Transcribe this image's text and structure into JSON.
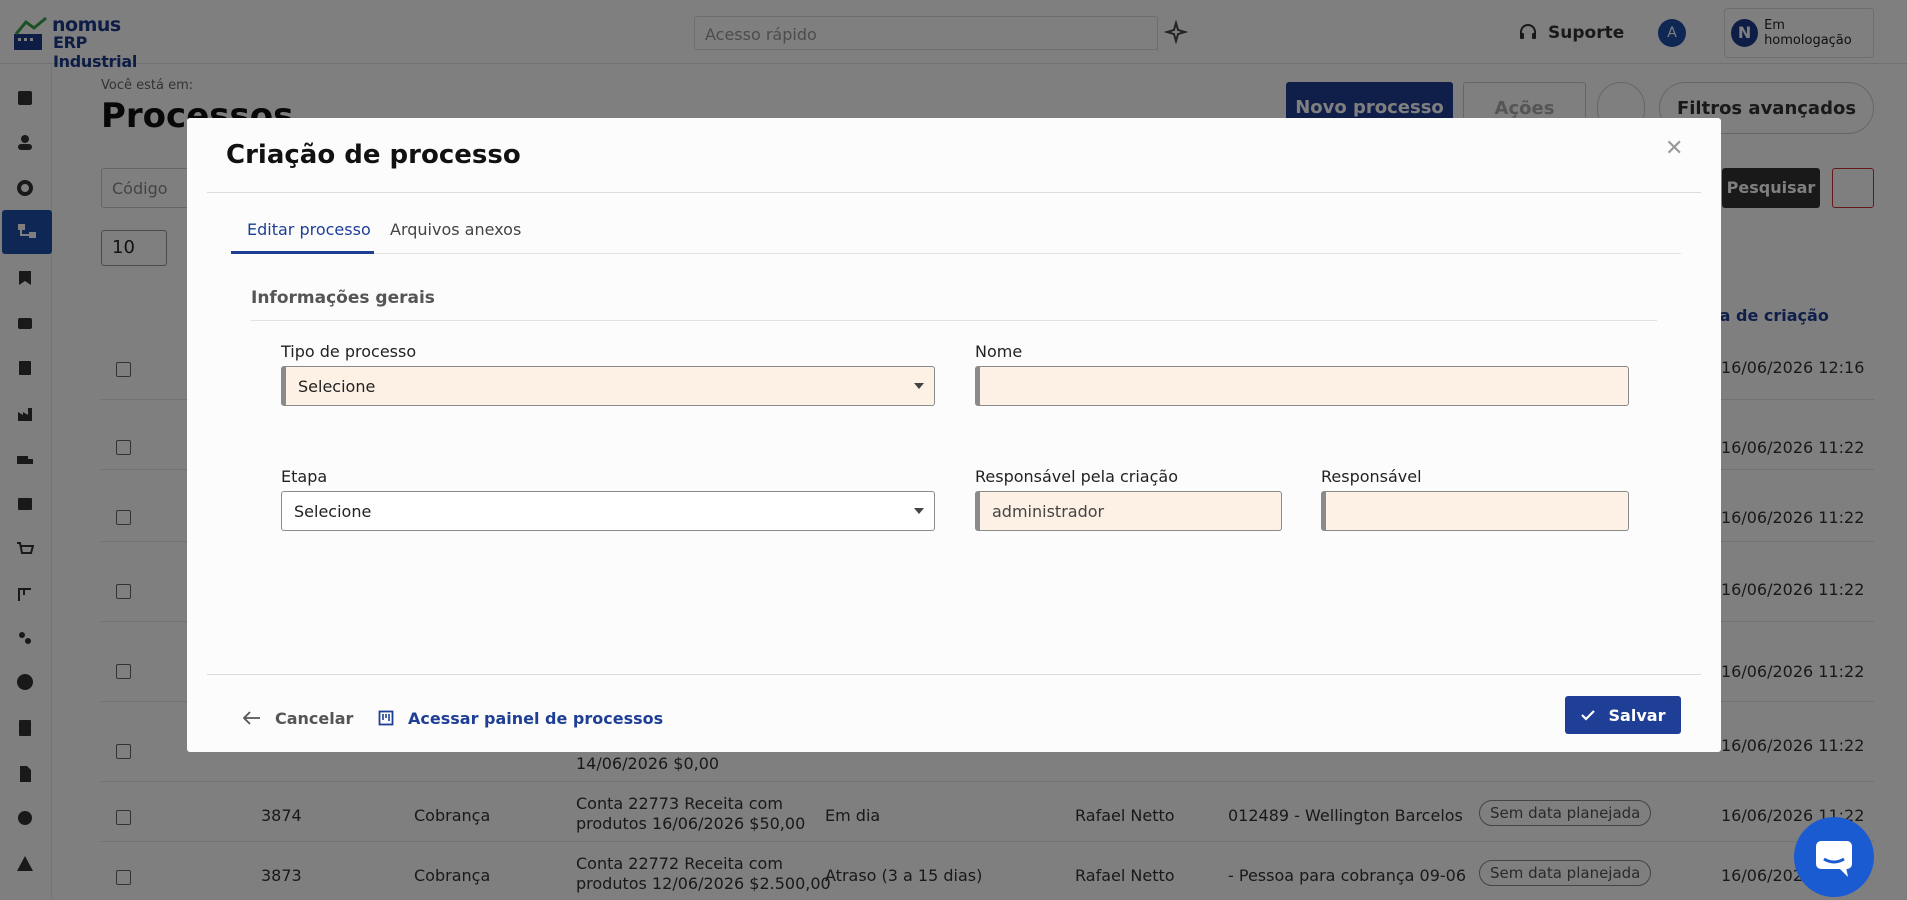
{
  "app": {
    "logo_line1": "nomus",
    "logo_line2": "ERP Industrial"
  },
  "topbar": {
    "quick_access_placeholder": "Acesso rápido",
    "support_label": "Suporte",
    "avatar_initial": "A",
    "environment_label": "Em homologação",
    "environment_initial": "N"
  },
  "page": {
    "breadcrumb": "Você está em:",
    "title": "Processos",
    "new_process_label": "Novo processo",
    "actions_label": "Ações",
    "advanced_filters_label": "Filtros avançados",
    "code_placeholder": "Código",
    "search_label": "Pesquisar",
    "page_size": "10",
    "date_column_header": "ta de criação"
  },
  "background_rows": [
    {
      "date": "16/06/2026 12:16"
    },
    {
      "date": "16/06/2026 11:22"
    },
    {
      "date": "16/06/2026 11:22"
    },
    {
      "date": "16/06/2026 11:22"
    },
    {
      "date": "16/06/2026 11:22"
    },
    {
      "date": "16/06/2026 11:22",
      "desc_tail": "14/06/2026 $0,00"
    },
    {
      "id": "3874",
      "type": "Cobrança",
      "desc_line1": "Conta 22773 Receita com",
      "desc_line2": "produtos 16/06/2026 $50,00",
      "status": "Em dia",
      "responsible": "Rafael Netto",
      "client": "012489 - Wellington Barcelos",
      "planned": "Sem data planejada",
      "date": "16/06/2026 11:22"
    },
    {
      "id": "3873",
      "type": "Cobrança",
      "desc_line1": "Conta 22772 Receita com",
      "desc_line2": "produtos 12/06/2026 $2.500,00",
      "status": "Atraso (3 a 15 dias)",
      "responsible": "Rafael Netto",
      "client": "- Pessoa para cobrança 09-06",
      "planned": "Sem data planejada",
      "date": "16/06/2026 11:22"
    }
  ],
  "modal": {
    "title": "Criação de processo",
    "tabs": [
      {
        "label": "Editar processo",
        "active": true
      },
      {
        "label": "Arquivos anexos",
        "active": false
      }
    ],
    "section_title": "Informações gerais",
    "fields": {
      "process_type": {
        "label": "Tipo de processo",
        "value": "Selecione"
      },
      "name": {
        "label": "Nome",
        "value": ""
      },
      "stage": {
        "label": "Etapa",
        "value": "Selecione"
      },
      "created_by": {
        "label": "Responsável pela criação",
        "value": "administrador"
      },
      "responsible": {
        "label": "Responsável",
        "value": ""
      }
    },
    "cancel_label": "Cancelar",
    "panel_link_label": "Acessar painel de processos",
    "save_label": "Salvar"
  },
  "colors": {
    "primary": "#1e3f95",
    "required_field_bg": "#fdf1e6",
    "overlay": "rgba(0,0,0,0.5)"
  },
  "icons": [
    "search-icon",
    "sparkle-icon",
    "headset-icon",
    "close-icon",
    "arrow-left-icon",
    "board-icon",
    "check-icon",
    "chat-icon"
  ]
}
